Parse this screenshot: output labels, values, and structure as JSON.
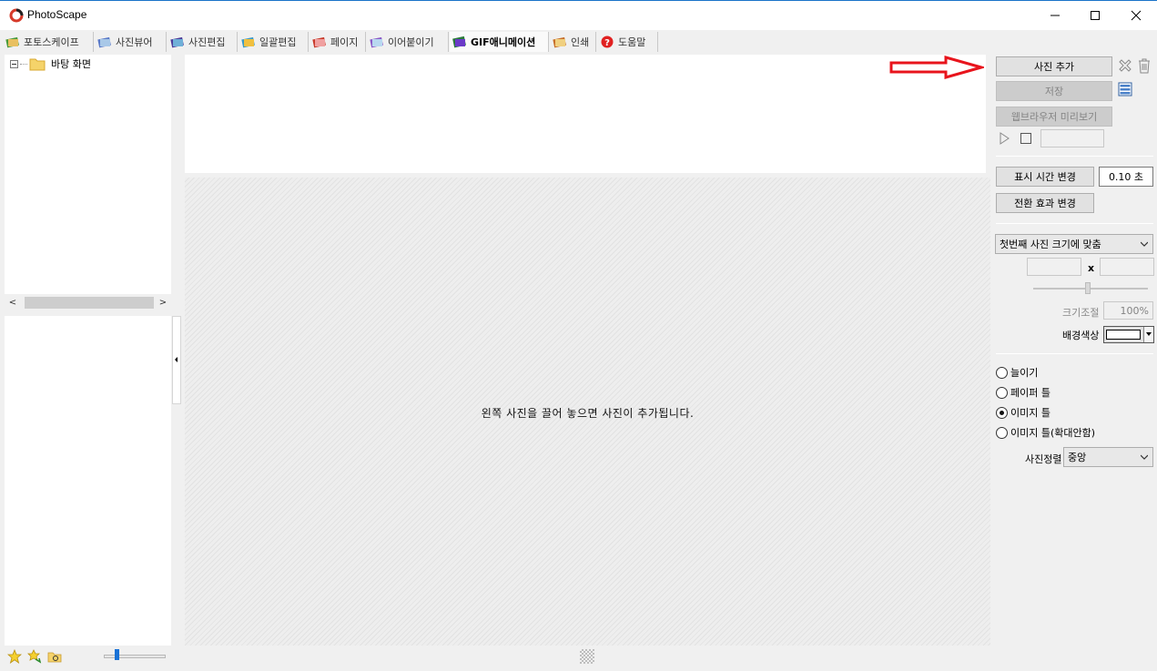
{
  "window": {
    "title": "PhotoScape"
  },
  "tabs": [
    {
      "label": "포토스케이프"
    },
    {
      "label": "사진뷰어"
    },
    {
      "label": "사진편집"
    },
    {
      "label": "일괄편집"
    },
    {
      "label": "페이지"
    },
    {
      "label": "이어붙이기"
    },
    {
      "label": "GIF애니메이션"
    },
    {
      "label": "인쇄"
    },
    {
      "label": "도움말"
    }
  ],
  "tree": {
    "root_label": "바탕 화면"
  },
  "canvas": {
    "hint": "왼쪽 사진을 끌어 놓으면 사진이 추가됩니다."
  },
  "right_panel": {
    "add_photo": "사진 추가",
    "save": "저장",
    "browser_preview": "웹브라우저 미리보기",
    "display_time_button": "표시 시간 변경",
    "display_time_value": "0.10 초",
    "transition_button": "전환 효과 변경",
    "size_mode": "첫번째 사진 크기에 맞춤",
    "size_separator": "x",
    "scale_label": "크기조절",
    "scale_value": "100%",
    "bg_color_label": "배경색상",
    "bg_color_value": "#ffffff",
    "fit_options": [
      {
        "label": "늘이기",
        "checked": false
      },
      {
        "label": "페이퍼 틀",
        "checked": false
      },
      {
        "label": "이미지 틀",
        "checked": true
      },
      {
        "label": "이미지 틀(확대안함)",
        "checked": false
      }
    ],
    "align_label": "사진정렬",
    "align_value": "중앙"
  },
  "colors": {
    "annotation_arrow": "#e8141c",
    "accent": "#1a72d6"
  }
}
